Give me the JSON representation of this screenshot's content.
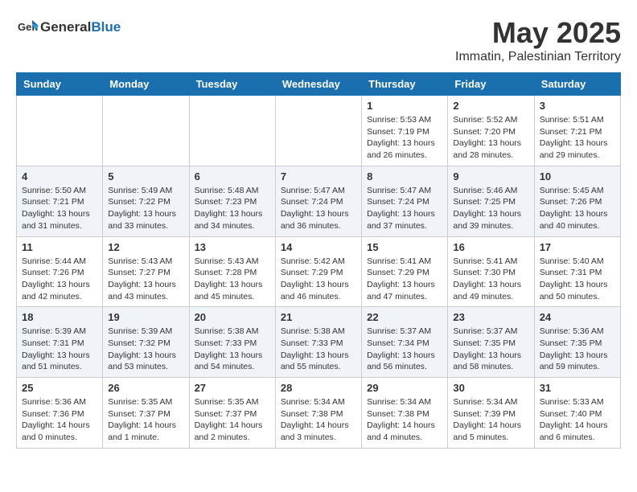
{
  "header": {
    "logo_general": "General",
    "logo_blue": "Blue",
    "month_year": "May 2025",
    "location": "Immatin, Palestinian Territory"
  },
  "weekdays": [
    "Sunday",
    "Monday",
    "Tuesday",
    "Wednesday",
    "Thursday",
    "Friday",
    "Saturday"
  ],
  "weeks": [
    [
      {
        "date": "",
        "info": ""
      },
      {
        "date": "",
        "info": ""
      },
      {
        "date": "",
        "info": ""
      },
      {
        "date": "",
        "info": ""
      },
      {
        "date": "1",
        "info": "Sunrise: 5:53 AM\nSunset: 7:19 PM\nDaylight: 13 hours\nand 26 minutes."
      },
      {
        "date": "2",
        "info": "Sunrise: 5:52 AM\nSunset: 7:20 PM\nDaylight: 13 hours\nand 28 minutes."
      },
      {
        "date": "3",
        "info": "Sunrise: 5:51 AM\nSunset: 7:21 PM\nDaylight: 13 hours\nand 29 minutes."
      }
    ],
    [
      {
        "date": "4",
        "info": "Sunrise: 5:50 AM\nSunset: 7:21 PM\nDaylight: 13 hours\nand 31 minutes."
      },
      {
        "date": "5",
        "info": "Sunrise: 5:49 AM\nSunset: 7:22 PM\nDaylight: 13 hours\nand 33 minutes."
      },
      {
        "date": "6",
        "info": "Sunrise: 5:48 AM\nSunset: 7:23 PM\nDaylight: 13 hours\nand 34 minutes."
      },
      {
        "date": "7",
        "info": "Sunrise: 5:47 AM\nSunset: 7:24 PM\nDaylight: 13 hours\nand 36 minutes."
      },
      {
        "date": "8",
        "info": "Sunrise: 5:47 AM\nSunset: 7:24 PM\nDaylight: 13 hours\nand 37 minutes."
      },
      {
        "date": "9",
        "info": "Sunrise: 5:46 AM\nSunset: 7:25 PM\nDaylight: 13 hours\nand 39 minutes."
      },
      {
        "date": "10",
        "info": "Sunrise: 5:45 AM\nSunset: 7:26 PM\nDaylight: 13 hours\nand 40 minutes."
      }
    ],
    [
      {
        "date": "11",
        "info": "Sunrise: 5:44 AM\nSunset: 7:26 PM\nDaylight: 13 hours\nand 42 minutes."
      },
      {
        "date": "12",
        "info": "Sunrise: 5:43 AM\nSunset: 7:27 PM\nDaylight: 13 hours\nand 43 minutes."
      },
      {
        "date": "13",
        "info": "Sunrise: 5:43 AM\nSunset: 7:28 PM\nDaylight: 13 hours\nand 45 minutes."
      },
      {
        "date": "14",
        "info": "Sunrise: 5:42 AM\nSunset: 7:29 PM\nDaylight: 13 hours\nand 46 minutes."
      },
      {
        "date": "15",
        "info": "Sunrise: 5:41 AM\nSunset: 7:29 PM\nDaylight: 13 hours\nand 47 minutes."
      },
      {
        "date": "16",
        "info": "Sunrise: 5:41 AM\nSunset: 7:30 PM\nDaylight: 13 hours\nand 49 minutes."
      },
      {
        "date": "17",
        "info": "Sunrise: 5:40 AM\nSunset: 7:31 PM\nDaylight: 13 hours\nand 50 minutes."
      }
    ],
    [
      {
        "date": "18",
        "info": "Sunrise: 5:39 AM\nSunset: 7:31 PM\nDaylight: 13 hours\nand 51 minutes."
      },
      {
        "date": "19",
        "info": "Sunrise: 5:39 AM\nSunset: 7:32 PM\nDaylight: 13 hours\nand 53 minutes."
      },
      {
        "date": "20",
        "info": "Sunrise: 5:38 AM\nSunset: 7:33 PM\nDaylight: 13 hours\nand 54 minutes."
      },
      {
        "date": "21",
        "info": "Sunrise: 5:38 AM\nSunset: 7:33 PM\nDaylight: 13 hours\nand 55 minutes."
      },
      {
        "date": "22",
        "info": "Sunrise: 5:37 AM\nSunset: 7:34 PM\nDaylight: 13 hours\nand 56 minutes."
      },
      {
        "date": "23",
        "info": "Sunrise: 5:37 AM\nSunset: 7:35 PM\nDaylight: 13 hours\nand 58 minutes."
      },
      {
        "date": "24",
        "info": "Sunrise: 5:36 AM\nSunset: 7:35 PM\nDaylight: 13 hours\nand 59 minutes."
      }
    ],
    [
      {
        "date": "25",
        "info": "Sunrise: 5:36 AM\nSunset: 7:36 PM\nDaylight: 14 hours\nand 0 minutes."
      },
      {
        "date": "26",
        "info": "Sunrise: 5:35 AM\nSunset: 7:37 PM\nDaylight: 14 hours\nand 1 minute."
      },
      {
        "date": "27",
        "info": "Sunrise: 5:35 AM\nSunset: 7:37 PM\nDaylight: 14 hours\nand 2 minutes."
      },
      {
        "date": "28",
        "info": "Sunrise: 5:34 AM\nSunset: 7:38 PM\nDaylight: 14 hours\nand 3 minutes."
      },
      {
        "date": "29",
        "info": "Sunrise: 5:34 AM\nSunset: 7:38 PM\nDaylight: 14 hours\nand 4 minutes."
      },
      {
        "date": "30",
        "info": "Sunrise: 5:34 AM\nSunset: 7:39 PM\nDaylight: 14 hours\nand 5 minutes."
      },
      {
        "date": "31",
        "info": "Sunrise: 5:33 AM\nSunset: 7:40 PM\nDaylight: 14 hours\nand 6 minutes."
      }
    ]
  ]
}
